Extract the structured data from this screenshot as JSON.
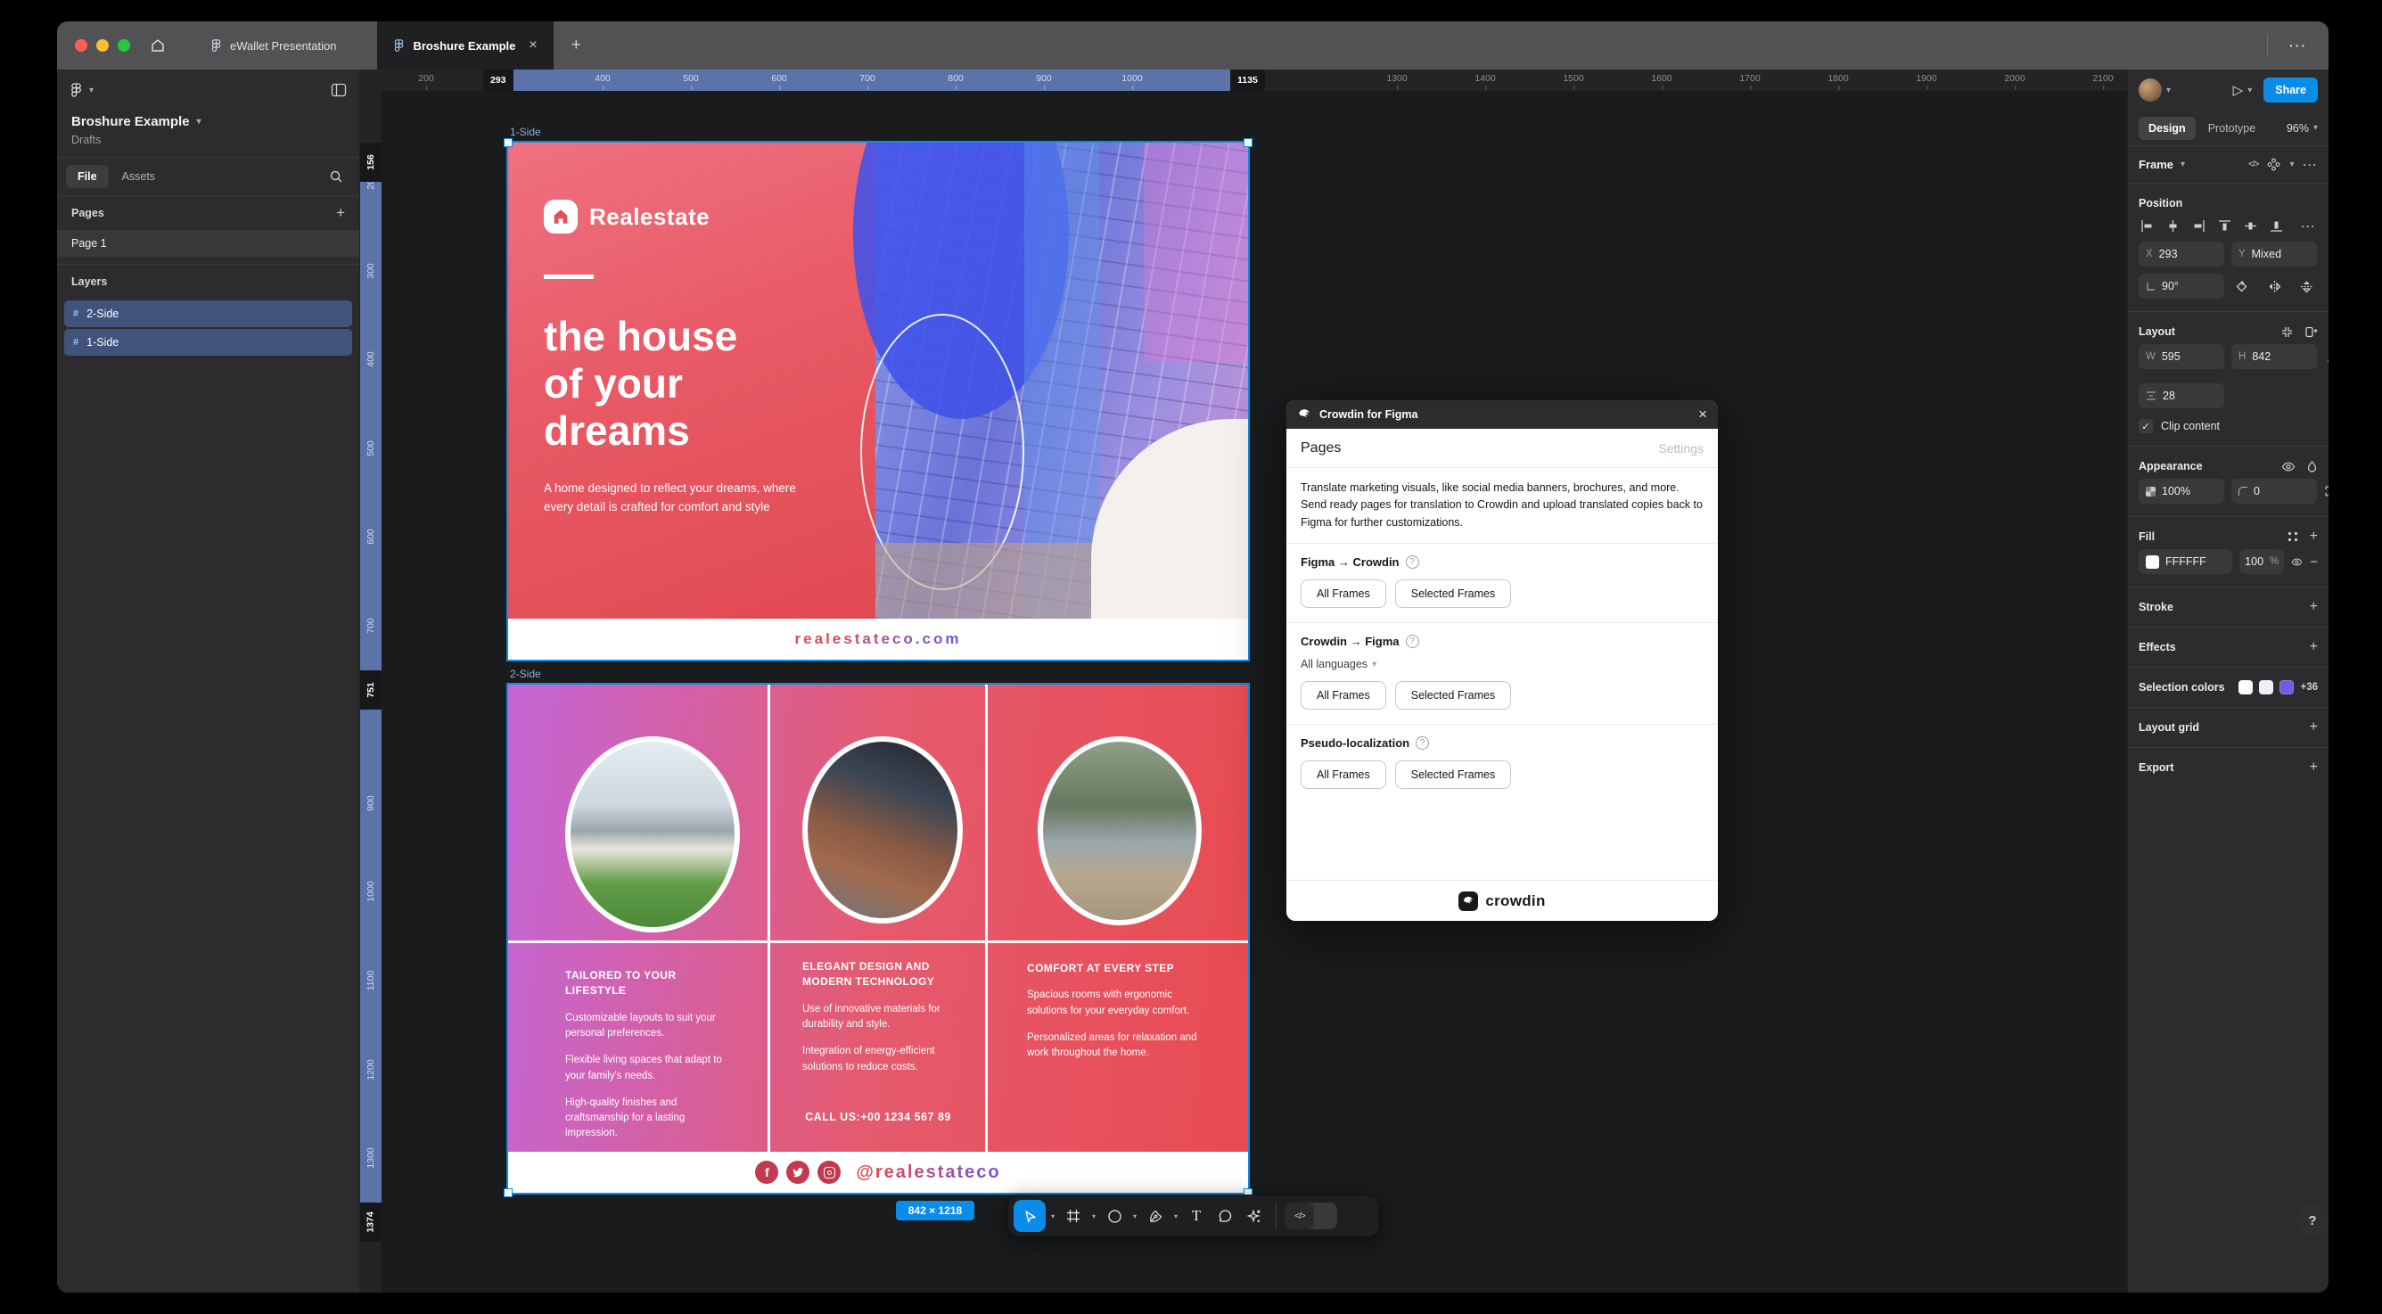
{
  "icons": {
    "chevron": "▾",
    "close": "×",
    "plus": "+",
    "overflow": "···",
    "play": "▷",
    "question": "?",
    "check": "✓",
    "minus": "−",
    "search_hint": "",
    "code": "</>",
    "hash": "#",
    "fb": "f"
  },
  "titlebar": {
    "tab1": "eWallet Presentation",
    "tab2": "Broshure Example"
  },
  "sidebar": {
    "title": "Broshure Example",
    "subtitle": "Drafts",
    "tab_file": "File",
    "tab_assets": "Assets",
    "pages_label": "Pages",
    "page1": "Page 1",
    "layers_label": "Layers",
    "layer1": "2-Side",
    "layer2": "1-Side"
  },
  "rulers": {
    "h_start": "293",
    "h_end": "1135",
    "h_labels": [
      "200",
      "400",
      "500",
      "600",
      "700",
      "800",
      "900",
      "1000",
      "1300",
      "1400",
      "1500",
      "1600",
      "1700",
      "1800",
      "1900",
      "2000",
      "2100"
    ],
    "v_start": "156",
    "v_mid": "751",
    "v_end": "1374",
    "v_labels": [
      "200",
      "300",
      "400",
      "500",
      "600",
      "700",
      "900",
      "1000",
      "1100",
      "1200",
      "1300"
    ]
  },
  "canvas": {
    "frame1_label": "1-Side",
    "frame2_label": "2-Side",
    "size_badge": "842 × 1218"
  },
  "brochure1": {
    "brand": "Realestate",
    "headline1": "the house",
    "headline2": "of your",
    "headline3": "dreams",
    "body": "A home designed to reflect your dreams, where every detail is crafted for comfort and style",
    "website": "realestateco.com"
  },
  "brochure2": {
    "columns": [
      {
        "heading": "TAILORED TO YOUR LIFESTYLE",
        "paras": [
          "Customizable layouts to suit your personal preferences.",
          "Flexible living spaces that adapt to your family's needs.",
          "High-quality finishes and craftsmanship for a lasting impression."
        ]
      },
      {
        "heading": "ELEGANT DESIGN AND MODERN TECHNOLOGY",
        "paras": [
          "Use of innovative materials for durability and style.",
          "Integration of energy-efficient solutions to reduce costs."
        ]
      },
      {
        "heading": "COMFORT AT EVERY STEP",
        "paras": [
          "Spacious rooms with ergonomic solutions for your everyday comfort.",
          "Personalized areas for relaxation and work throughout the home."
        ]
      }
    ],
    "call": "CALL US:+00 1234 567 89",
    "handle": "@realestateco"
  },
  "dialog": {
    "title": "Crowdin for Figma",
    "tab_pages": "Pages",
    "tab_settings": "Settings",
    "description": "Translate marketing visuals, like social media banners, brochures, and more. Send ready pages for translation to Crowdin and upload translated copies back to Figma for further customizations.",
    "sections": [
      {
        "label": "Figma → Crowdin"
      },
      {
        "label": "Crowdin → Figma",
        "dropdown": "All languages"
      },
      {
        "label": "Pseudo-localization"
      }
    ],
    "btn_all": "All Frames",
    "btn_selected": "Selected Frames",
    "brand": "crowdin"
  },
  "inspector": {
    "tab_design": "Design",
    "tab_prototype": "Prototype",
    "zoom": "96%",
    "share": "Share",
    "selection_type": "Frame",
    "position_label": "Position",
    "x_label": "X",
    "x_value": "293",
    "y_label": "Y",
    "y_value": "Mixed",
    "rotation": "90°",
    "layout_label": "Layout",
    "w_label": "W",
    "w_value": "595",
    "h_label": "H",
    "h_value": "842",
    "gap_value": "28",
    "clip_label": "Clip content",
    "appearance_label": "Appearance",
    "opacity": "100%",
    "radius": "0",
    "fill_label": "Fill",
    "fill_hex": "FFFFFF",
    "fill_opacity": "100",
    "percent": "%",
    "stroke_label": "Stroke",
    "effects_label": "Effects",
    "selection_colors_label": "Selection colors",
    "selection_more": "+36",
    "layout_grid_label": "Layout grid",
    "export_label": "Export"
  },
  "colors": {
    "accent": "#0c8ce9",
    "ruler_band": "#5b73a8",
    "layer_selected": "#41537b",
    "fill_swatch": "#FFFFFF",
    "selection_swatches": [
      "#FFFFFF",
      "#EEF1F4",
      "#6A5FE0"
    ]
  }
}
